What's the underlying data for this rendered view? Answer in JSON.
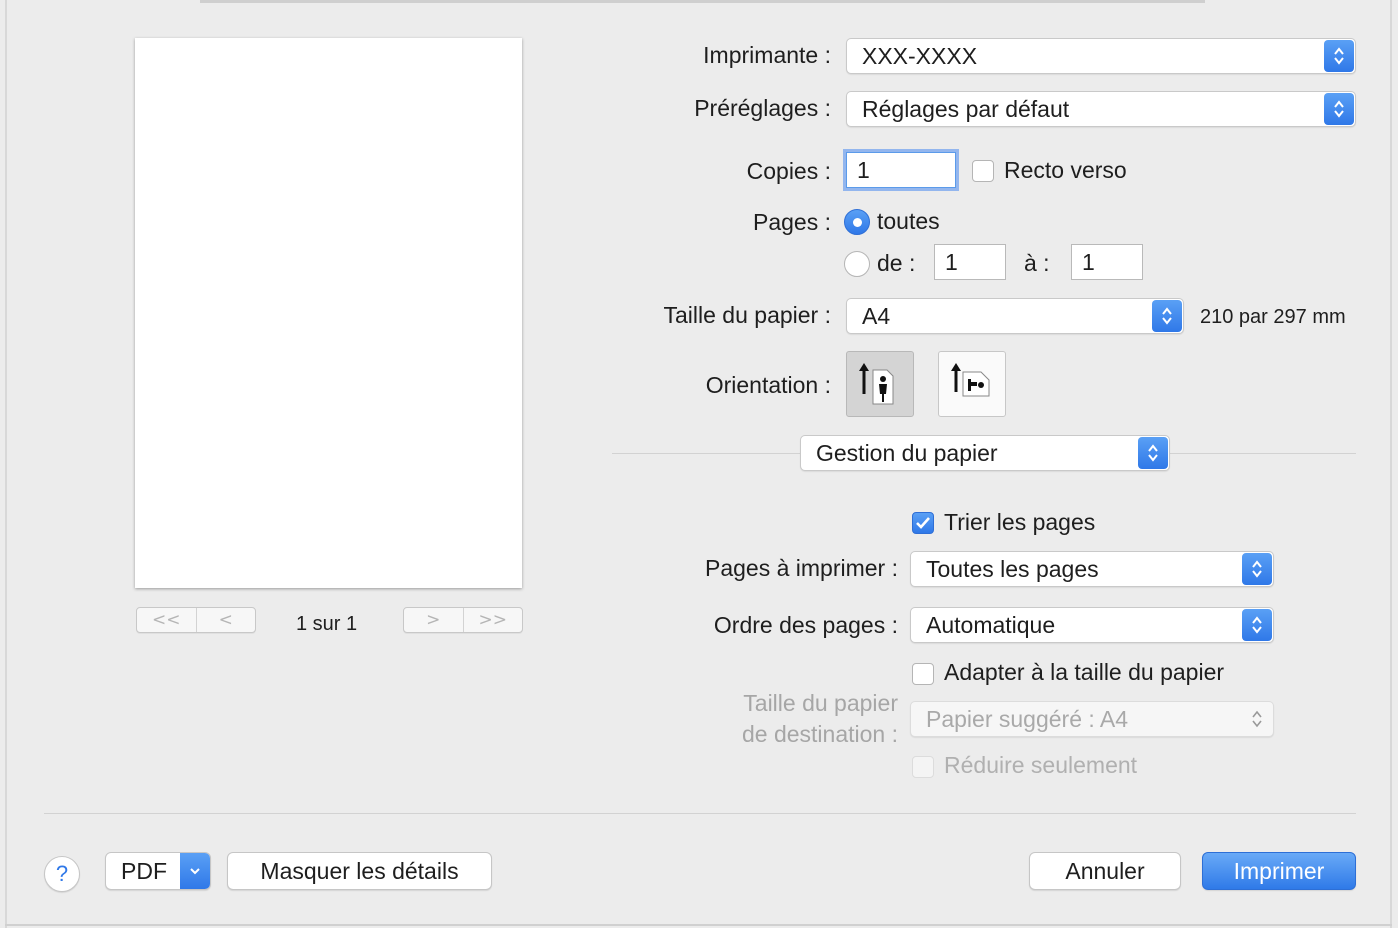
{
  "printer": {
    "label": "Imprimante :",
    "value": "XXX-XXXX"
  },
  "presets": {
    "label": "Préréglages :",
    "value": "Réglages par défaut"
  },
  "copies": {
    "label": "Copies :",
    "value": "1",
    "duplex_label": "Recto verso",
    "duplex_checked": false
  },
  "pages": {
    "label": "Pages :",
    "all_label": "toutes",
    "from_label": "de :",
    "to_label": "à :",
    "from_value": "1",
    "to_value": "1",
    "selected": "all"
  },
  "paper_size": {
    "label": "Taille du papier :",
    "value": "A4",
    "dimensions": "210 par 297 mm"
  },
  "orientation": {
    "label": "Orientation :",
    "options": [
      "portrait-icon",
      "landscape-icon"
    ],
    "selected": "portrait"
  },
  "section_popup": {
    "value": "Gestion du papier"
  },
  "paper_handling": {
    "collate_label": "Trier les pages",
    "collate_checked": true,
    "pages_to_print_label": "Pages à imprimer :",
    "pages_to_print_value": "Toutes les pages",
    "page_order_label": "Ordre des pages :",
    "page_order_value": "Automatique",
    "scale_label": "Adapter à la taille du papier",
    "scale_checked": false,
    "dest_label_line1": "Taille du papier",
    "dest_label_line2": "de destination :",
    "dest_value": "Papier suggéré : A4",
    "scale_down_label": "Réduire seulement",
    "scale_down_checked": false
  },
  "preview": {
    "page_indicator": "1 sur 1",
    "nav": {
      "first": "<<",
      "prev": "<",
      "next": ">",
      "last": ">>"
    }
  },
  "footer": {
    "help_label": "?",
    "pdf_label": "PDF",
    "hide_details_label": "Masquer les détails",
    "cancel_label": "Annuler",
    "print_label": "Imprimer"
  },
  "colors": {
    "accent": "#2f78e8",
    "background": "#ececec"
  }
}
